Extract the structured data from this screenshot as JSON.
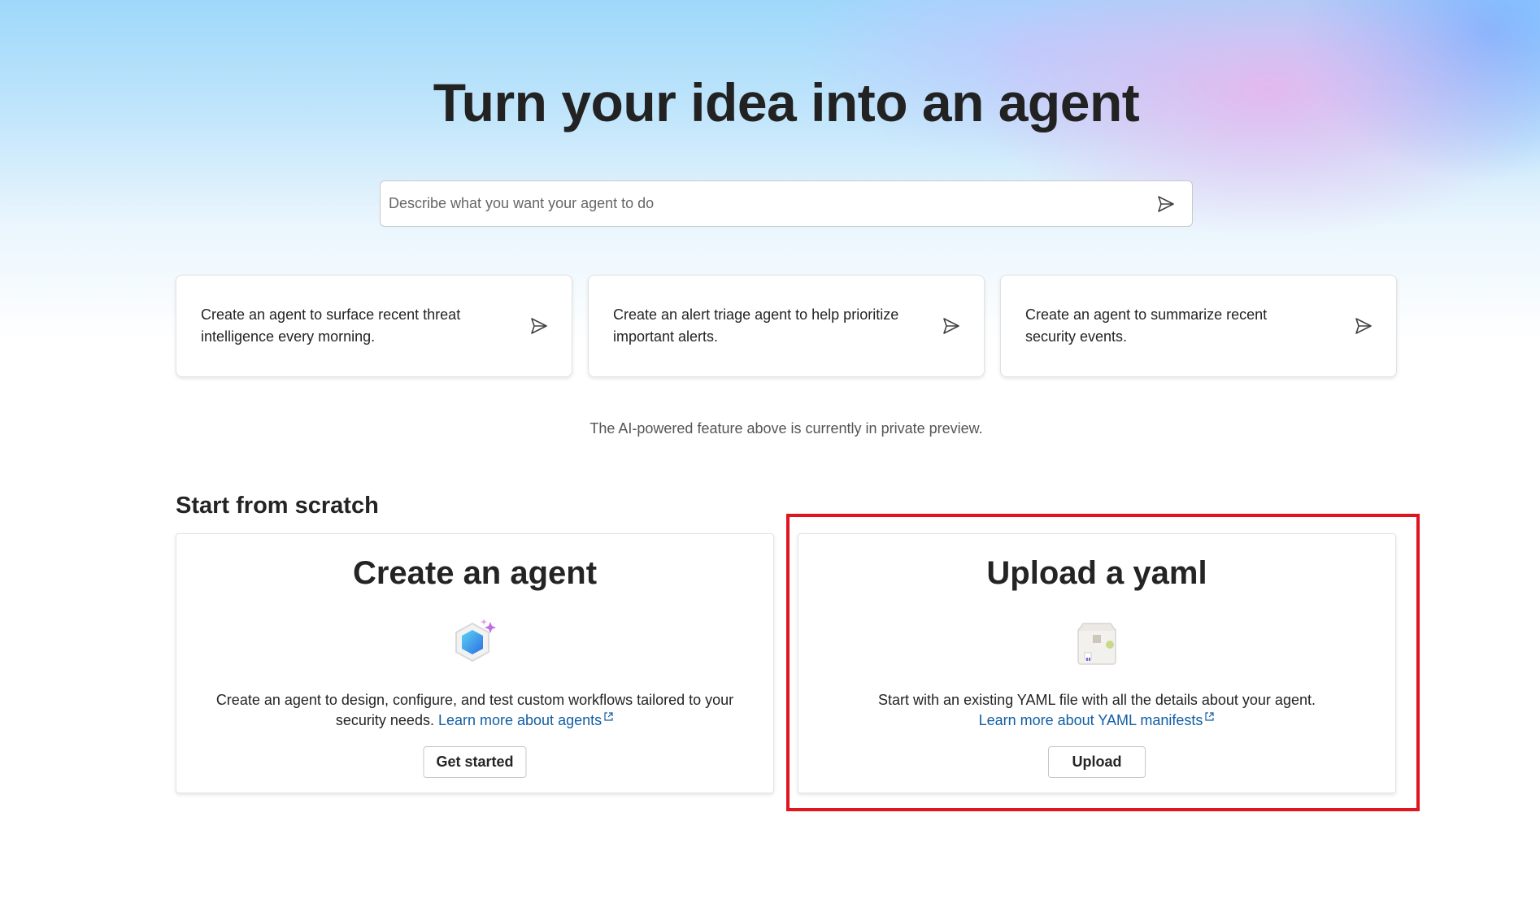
{
  "hero": {
    "title": "Turn your idea into an agent",
    "prompt_placeholder": "Describe what you want your agent to do",
    "send_icon": "send-icon"
  },
  "suggestions": [
    {
      "text": "Create an agent to surface recent threat intelligence every morning."
    },
    {
      "text": "Create an alert triage agent to help prioritize important alerts."
    },
    {
      "text": "Create an agent to summarize recent security events."
    }
  ],
  "preview_note": "The AI-powered feature above is currently in private preview.",
  "scratch": {
    "heading": "Start from scratch",
    "create": {
      "title": "Create an agent",
      "icon": "agent-hexagon-icon",
      "description": "Create an agent to design, configure, and test custom workflows tailored to your security needs.",
      "link": "Learn more about agents",
      "button": "Get started"
    },
    "upload": {
      "title": "Upload a yaml",
      "icon": "yaml-package-icon",
      "description": "Start with an existing YAML file with all the details about your agent.",
      "link": "Learn more about YAML manifests",
      "button": "Upload"
    }
  },
  "colors": {
    "link": "#115ea3",
    "highlight": "#e0151f"
  }
}
